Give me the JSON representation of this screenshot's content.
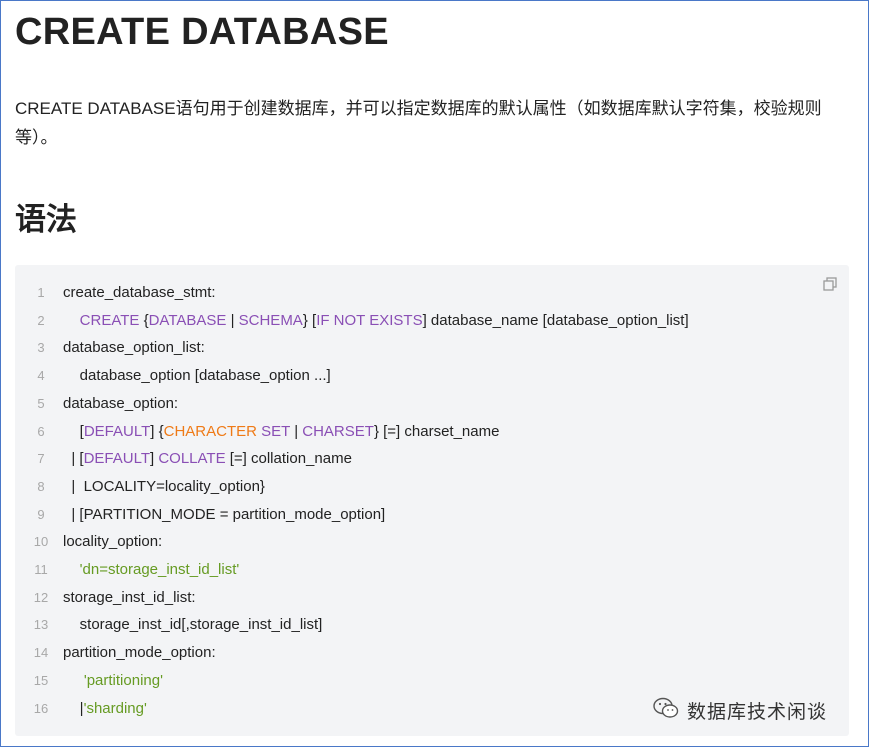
{
  "title": "CREATE DATABASE",
  "description": "CREATE DATABASE语句用于创建数据库，并可以指定数据库的默认属性（如数据库默认字符集，校验规则等）。",
  "syntax_heading": "语法",
  "copy_icon": "copy-icon",
  "code_lines": [
    {
      "num": "1",
      "segments": [
        {
          "t": "create_database_stmt:",
          "c": ""
        }
      ]
    },
    {
      "num": "2",
      "segments": [
        {
          "t": "    ",
          "c": ""
        },
        {
          "t": "CREATE",
          "c": "kw"
        },
        {
          "t": " {",
          "c": ""
        },
        {
          "t": "DATABASE",
          "c": "kw"
        },
        {
          "t": " | ",
          "c": ""
        },
        {
          "t": "SCHEMA",
          "c": "kw"
        },
        {
          "t": "} [",
          "c": ""
        },
        {
          "t": "IF NOT EXISTS",
          "c": "kw"
        },
        {
          "t": "] database_name [database_option_list]",
          "c": ""
        }
      ]
    },
    {
      "num": "3",
      "segments": [
        {
          "t": "database_option_list:",
          "c": ""
        }
      ]
    },
    {
      "num": "4",
      "segments": [
        {
          "t": "    database_option [database_option ...]",
          "c": ""
        }
      ]
    },
    {
      "num": "5",
      "segments": [
        {
          "t": "database_option:",
          "c": ""
        }
      ]
    },
    {
      "num": "6",
      "segments": [
        {
          "t": "    [",
          "c": ""
        },
        {
          "t": "DEFAULT",
          "c": "kw"
        },
        {
          "t": "] {",
          "c": ""
        },
        {
          "t": "CHARACTER",
          "c": "fn"
        },
        {
          "t": " ",
          "c": ""
        },
        {
          "t": "SET",
          "c": "kw"
        },
        {
          "t": " | ",
          "c": ""
        },
        {
          "t": "CHARSET",
          "c": "kw"
        },
        {
          "t": "} [=] charset_name",
          "c": ""
        }
      ]
    },
    {
      "num": "7",
      "segments": [
        {
          "t": "  | [",
          "c": ""
        },
        {
          "t": "DEFAULT",
          "c": "kw"
        },
        {
          "t": "] ",
          "c": ""
        },
        {
          "t": "COLLATE",
          "c": "kw"
        },
        {
          "t": " [=] collation_name",
          "c": ""
        }
      ]
    },
    {
      "num": "8",
      "segments": [
        {
          "t": "  |  LOCALITY=locality_option}",
          "c": ""
        }
      ]
    },
    {
      "num": "9",
      "segments": [
        {
          "t": "  | [PARTITION_MODE = partition_mode_option]",
          "c": ""
        }
      ]
    },
    {
      "num": "10",
      "segments": [
        {
          "t": "locality_option:",
          "c": ""
        }
      ]
    },
    {
      "num": "11",
      "segments": [
        {
          "t": "    ",
          "c": ""
        },
        {
          "t": "'dn=storage_inst_id_list'",
          "c": "str"
        }
      ]
    },
    {
      "num": "12",
      "segments": [
        {
          "t": "storage_inst_id_list:",
          "c": ""
        }
      ]
    },
    {
      "num": "13",
      "segments": [
        {
          "t": "    storage_inst_id[,storage_inst_id_list]",
          "c": ""
        }
      ]
    },
    {
      "num": "14",
      "segments": [
        {
          "t": "partition_mode_option:",
          "c": ""
        }
      ]
    },
    {
      "num": "15",
      "segments": [
        {
          "t": "     ",
          "c": ""
        },
        {
          "t": "'partitioning'",
          "c": "str"
        }
      ]
    },
    {
      "num": "16",
      "segments": [
        {
          "t": "    |",
          "c": ""
        },
        {
          "t": "'sharding'",
          "c": "str"
        }
      ]
    }
  ],
  "watermark": {
    "icon": "wechat-icon",
    "text": "数据库技术闲谈"
  }
}
